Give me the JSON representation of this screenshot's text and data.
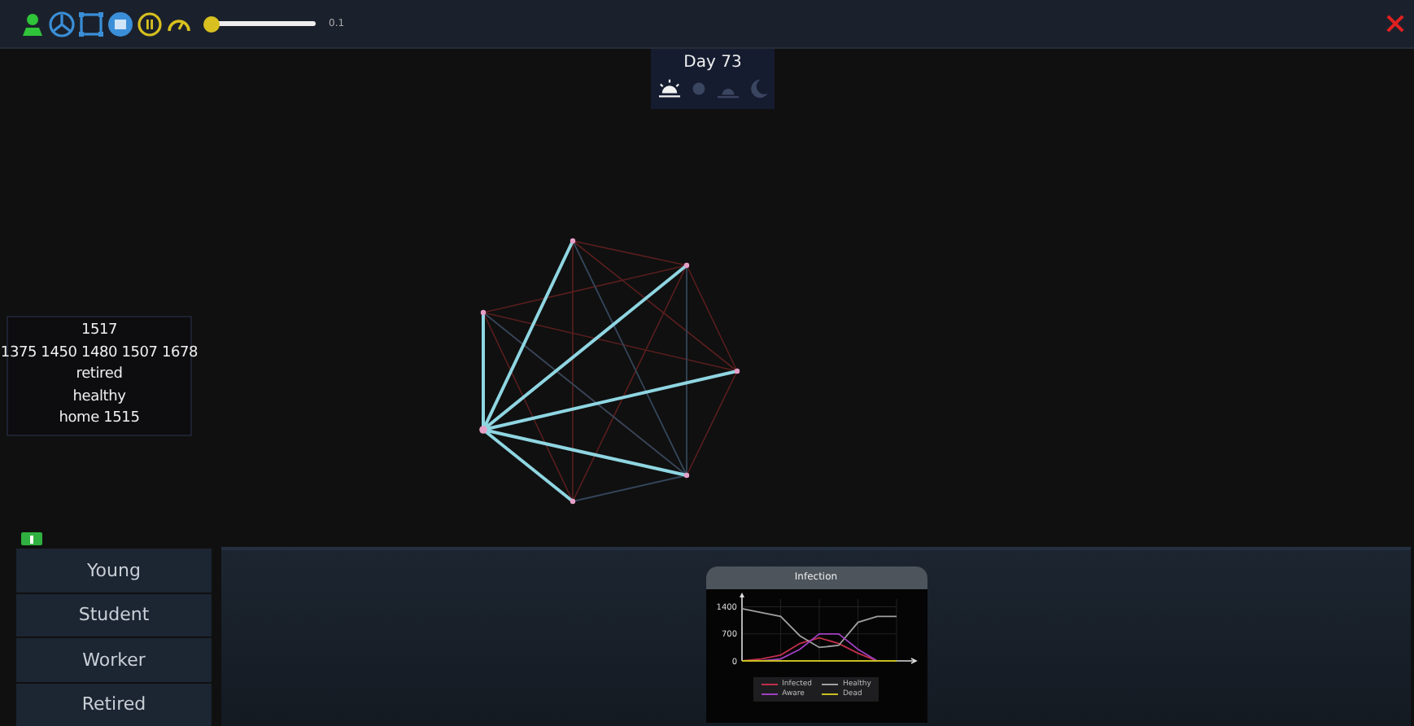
{
  "toolbar": {
    "speed_slider": {
      "level": 0.02
    },
    "speed_reading": "0.1"
  },
  "day_panel": {
    "title": "Day 73",
    "phases": [
      {
        "kind": "sunrise",
        "selected": true
      },
      {
        "kind": "sun",
        "selected": false
      },
      {
        "kind": "sunset",
        "selected": false
      },
      {
        "kind": "moon",
        "selected": false
      }
    ]
  },
  "info_box": {
    "lines": [
      "1517",
      "1375 1450 1480 1507 1678",
      "retired",
      "healthy",
      "home 1515"
    ]
  },
  "groups": [
    {
      "label": "Young"
    },
    {
      "label": "Student"
    },
    {
      "label": "Worker"
    },
    {
      "label": "Retired"
    }
  ],
  "chart_card": {
    "title": "Infection",
    "chart_data": {
      "type": "line",
      "grid": true,
      "yticks": [
        0,
        700,
        1400
      ],
      "ylim": [
        0,
        1600
      ],
      "series": [
        {
          "name": "Infected",
          "color": "#c0304a",
          "values": [
            0,
            50,
            150,
            450,
            600,
            450,
            200,
            0,
            0
          ]
        },
        {
          "name": "Healthy",
          "color": "#a0a0a0",
          "values": [
            1350,
            1250,
            1150,
            650,
            350,
            400,
            1000,
            1150,
            1150
          ]
        },
        {
          "name": "Aware",
          "color": "#a040c0",
          "values": [
            0,
            0,
            50,
            300,
            700,
            700,
            300,
            0,
            0
          ]
        },
        {
          "name": "Dead",
          "color": "#c8c020",
          "values": [
            0,
            0,
            0,
            0,
            0,
            0,
            0,
            0,
            0
          ]
        }
      ]
    }
  }
}
